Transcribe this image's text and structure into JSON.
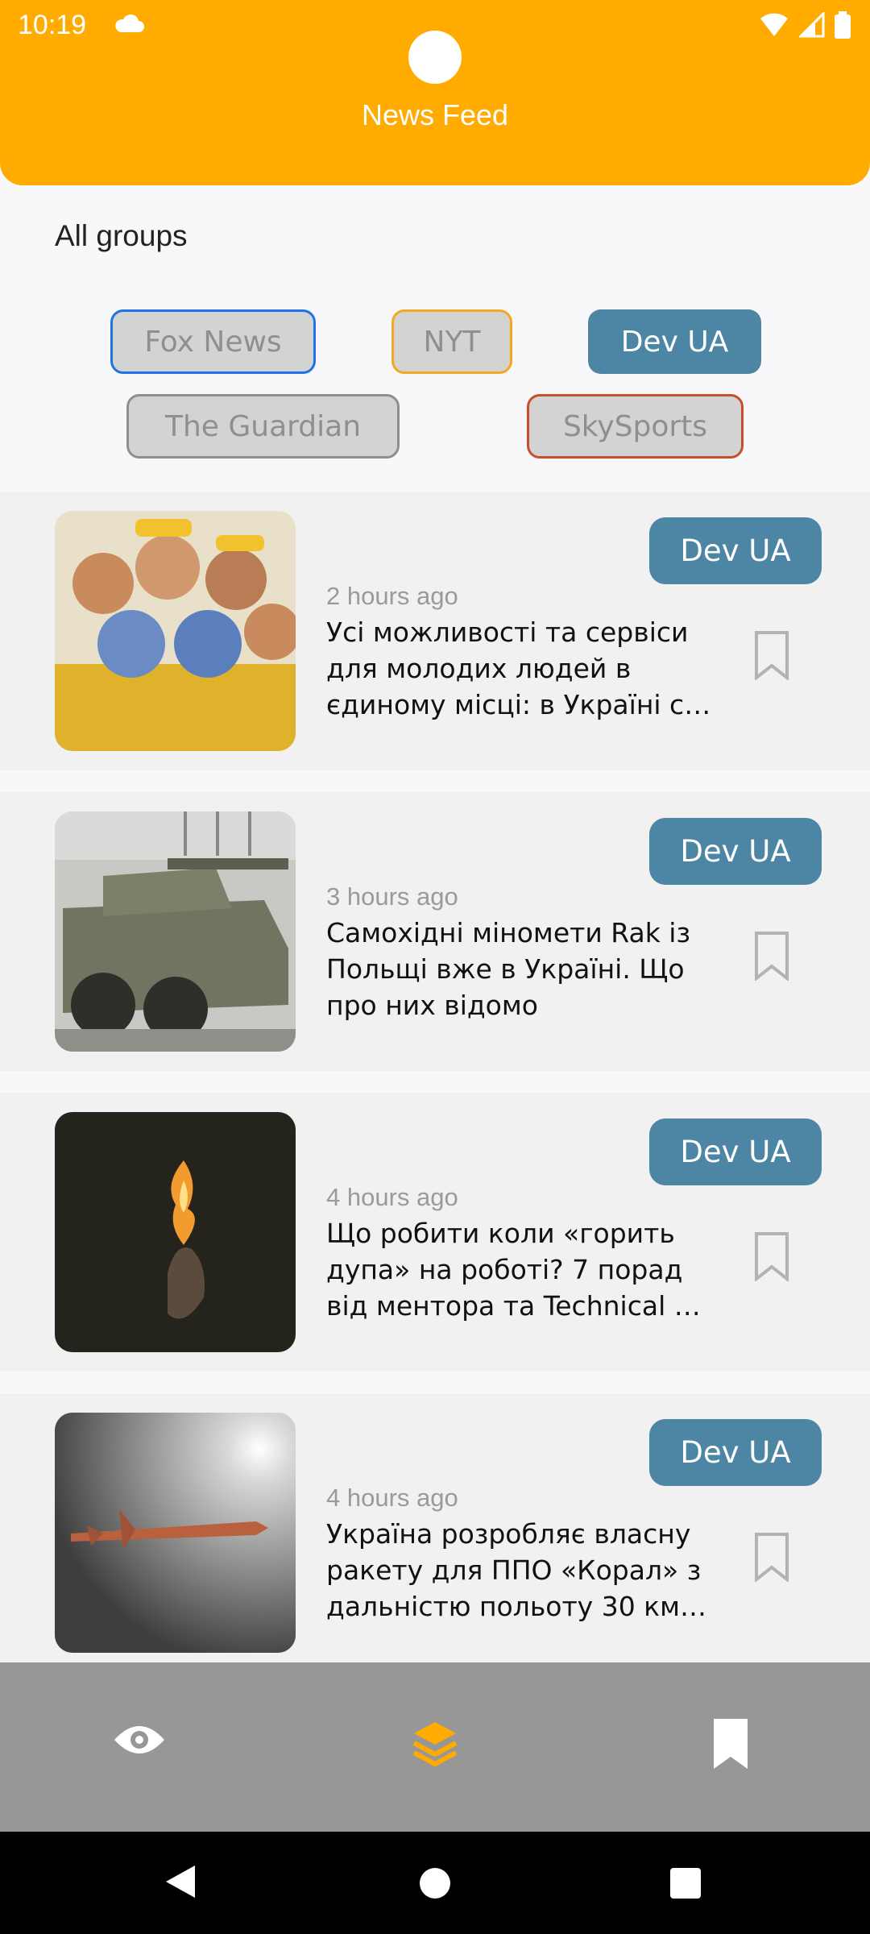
{
  "status": {
    "time": "10:19"
  },
  "header": {
    "title": "News Feed"
  },
  "groups": {
    "label": "All groups",
    "chips": [
      "Fox News",
      "NYT",
      "Dev UA",
      "The Guardian",
      "SkySports"
    ]
  },
  "feed": [
    {
      "source": "Dev UA",
      "time": "2 hours ago",
      "title": "Усі можливості та сервіси для молодих людей в єдиному місці: в Україні с…"
    },
    {
      "source": "Dev UA",
      "time": "3 hours ago",
      "title": "Самохідні міномети Rak із Польщі вже в Україні. Що про них відомо"
    },
    {
      "source": "Dev UA",
      "time": "4 hours ago",
      "title": "Що робити коли «горить дупа» на роботі? 7 порад від ментора та Technical …"
    },
    {
      "source": "Dev UA",
      "time": "4 hours ago",
      "title": "Україна розробляє власну ракету для ППО «Корал» з дальністю польоту 30 км. …"
    }
  ],
  "bottom_nav": {
    "items": [
      "eye-icon",
      "layers-icon",
      "bookmark-icon"
    ],
    "active": "layers-icon"
  },
  "colors": {
    "header": "#ffab00",
    "accent": "#4d86a5",
    "nav_bg": "#979797",
    "active_icon": "#ffab00"
  }
}
